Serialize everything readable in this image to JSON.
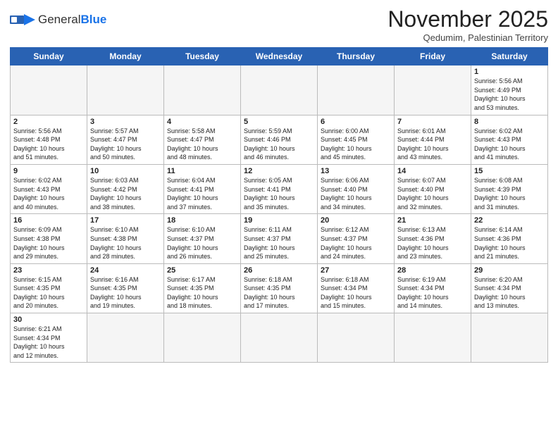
{
  "logo": {
    "text_general": "General",
    "text_blue": "Blue"
  },
  "header": {
    "month_title": "November 2025",
    "location": "Qedumim, Palestinian Territory"
  },
  "days_of_week": [
    "Sunday",
    "Monday",
    "Tuesday",
    "Wednesday",
    "Thursday",
    "Friday",
    "Saturday"
  ],
  "weeks": [
    [
      {
        "day": "",
        "info": ""
      },
      {
        "day": "",
        "info": ""
      },
      {
        "day": "",
        "info": ""
      },
      {
        "day": "",
        "info": ""
      },
      {
        "day": "",
        "info": ""
      },
      {
        "day": "",
        "info": ""
      },
      {
        "day": "1",
        "info": "Sunrise: 5:56 AM\nSunset: 4:49 PM\nDaylight: 10 hours\nand 53 minutes."
      }
    ],
    [
      {
        "day": "2",
        "info": "Sunrise: 5:56 AM\nSunset: 4:48 PM\nDaylight: 10 hours\nand 51 minutes."
      },
      {
        "day": "3",
        "info": "Sunrise: 5:57 AM\nSunset: 4:47 PM\nDaylight: 10 hours\nand 50 minutes."
      },
      {
        "day": "4",
        "info": "Sunrise: 5:58 AM\nSunset: 4:47 PM\nDaylight: 10 hours\nand 48 minutes."
      },
      {
        "day": "5",
        "info": "Sunrise: 5:59 AM\nSunset: 4:46 PM\nDaylight: 10 hours\nand 46 minutes."
      },
      {
        "day": "6",
        "info": "Sunrise: 6:00 AM\nSunset: 4:45 PM\nDaylight: 10 hours\nand 45 minutes."
      },
      {
        "day": "7",
        "info": "Sunrise: 6:01 AM\nSunset: 4:44 PM\nDaylight: 10 hours\nand 43 minutes."
      },
      {
        "day": "8",
        "info": "Sunrise: 6:02 AM\nSunset: 4:43 PM\nDaylight: 10 hours\nand 41 minutes."
      }
    ],
    [
      {
        "day": "9",
        "info": "Sunrise: 6:02 AM\nSunset: 4:43 PM\nDaylight: 10 hours\nand 40 minutes."
      },
      {
        "day": "10",
        "info": "Sunrise: 6:03 AM\nSunset: 4:42 PM\nDaylight: 10 hours\nand 38 minutes."
      },
      {
        "day": "11",
        "info": "Sunrise: 6:04 AM\nSunset: 4:41 PM\nDaylight: 10 hours\nand 37 minutes."
      },
      {
        "day": "12",
        "info": "Sunrise: 6:05 AM\nSunset: 4:41 PM\nDaylight: 10 hours\nand 35 minutes."
      },
      {
        "day": "13",
        "info": "Sunrise: 6:06 AM\nSunset: 4:40 PM\nDaylight: 10 hours\nand 34 minutes."
      },
      {
        "day": "14",
        "info": "Sunrise: 6:07 AM\nSunset: 4:40 PM\nDaylight: 10 hours\nand 32 minutes."
      },
      {
        "day": "15",
        "info": "Sunrise: 6:08 AM\nSunset: 4:39 PM\nDaylight: 10 hours\nand 31 minutes."
      }
    ],
    [
      {
        "day": "16",
        "info": "Sunrise: 6:09 AM\nSunset: 4:38 PM\nDaylight: 10 hours\nand 29 minutes."
      },
      {
        "day": "17",
        "info": "Sunrise: 6:10 AM\nSunset: 4:38 PM\nDaylight: 10 hours\nand 28 minutes."
      },
      {
        "day": "18",
        "info": "Sunrise: 6:10 AM\nSunset: 4:37 PM\nDaylight: 10 hours\nand 26 minutes."
      },
      {
        "day": "19",
        "info": "Sunrise: 6:11 AM\nSunset: 4:37 PM\nDaylight: 10 hours\nand 25 minutes."
      },
      {
        "day": "20",
        "info": "Sunrise: 6:12 AM\nSunset: 4:37 PM\nDaylight: 10 hours\nand 24 minutes."
      },
      {
        "day": "21",
        "info": "Sunrise: 6:13 AM\nSunset: 4:36 PM\nDaylight: 10 hours\nand 23 minutes."
      },
      {
        "day": "22",
        "info": "Sunrise: 6:14 AM\nSunset: 4:36 PM\nDaylight: 10 hours\nand 21 minutes."
      }
    ],
    [
      {
        "day": "23",
        "info": "Sunrise: 6:15 AM\nSunset: 4:35 PM\nDaylight: 10 hours\nand 20 minutes."
      },
      {
        "day": "24",
        "info": "Sunrise: 6:16 AM\nSunset: 4:35 PM\nDaylight: 10 hours\nand 19 minutes."
      },
      {
        "day": "25",
        "info": "Sunrise: 6:17 AM\nSunset: 4:35 PM\nDaylight: 10 hours\nand 18 minutes."
      },
      {
        "day": "26",
        "info": "Sunrise: 6:18 AM\nSunset: 4:35 PM\nDaylight: 10 hours\nand 17 minutes."
      },
      {
        "day": "27",
        "info": "Sunrise: 6:18 AM\nSunset: 4:34 PM\nDaylight: 10 hours\nand 15 minutes."
      },
      {
        "day": "28",
        "info": "Sunrise: 6:19 AM\nSunset: 4:34 PM\nDaylight: 10 hours\nand 14 minutes."
      },
      {
        "day": "29",
        "info": "Sunrise: 6:20 AM\nSunset: 4:34 PM\nDaylight: 10 hours\nand 13 minutes."
      }
    ],
    [
      {
        "day": "30",
        "info": "Sunrise: 6:21 AM\nSunset: 4:34 PM\nDaylight: 10 hours\nand 12 minutes."
      },
      {
        "day": "",
        "info": ""
      },
      {
        "day": "",
        "info": ""
      },
      {
        "day": "",
        "info": ""
      },
      {
        "day": "",
        "info": ""
      },
      {
        "day": "",
        "info": ""
      },
      {
        "day": "",
        "info": ""
      }
    ]
  ]
}
